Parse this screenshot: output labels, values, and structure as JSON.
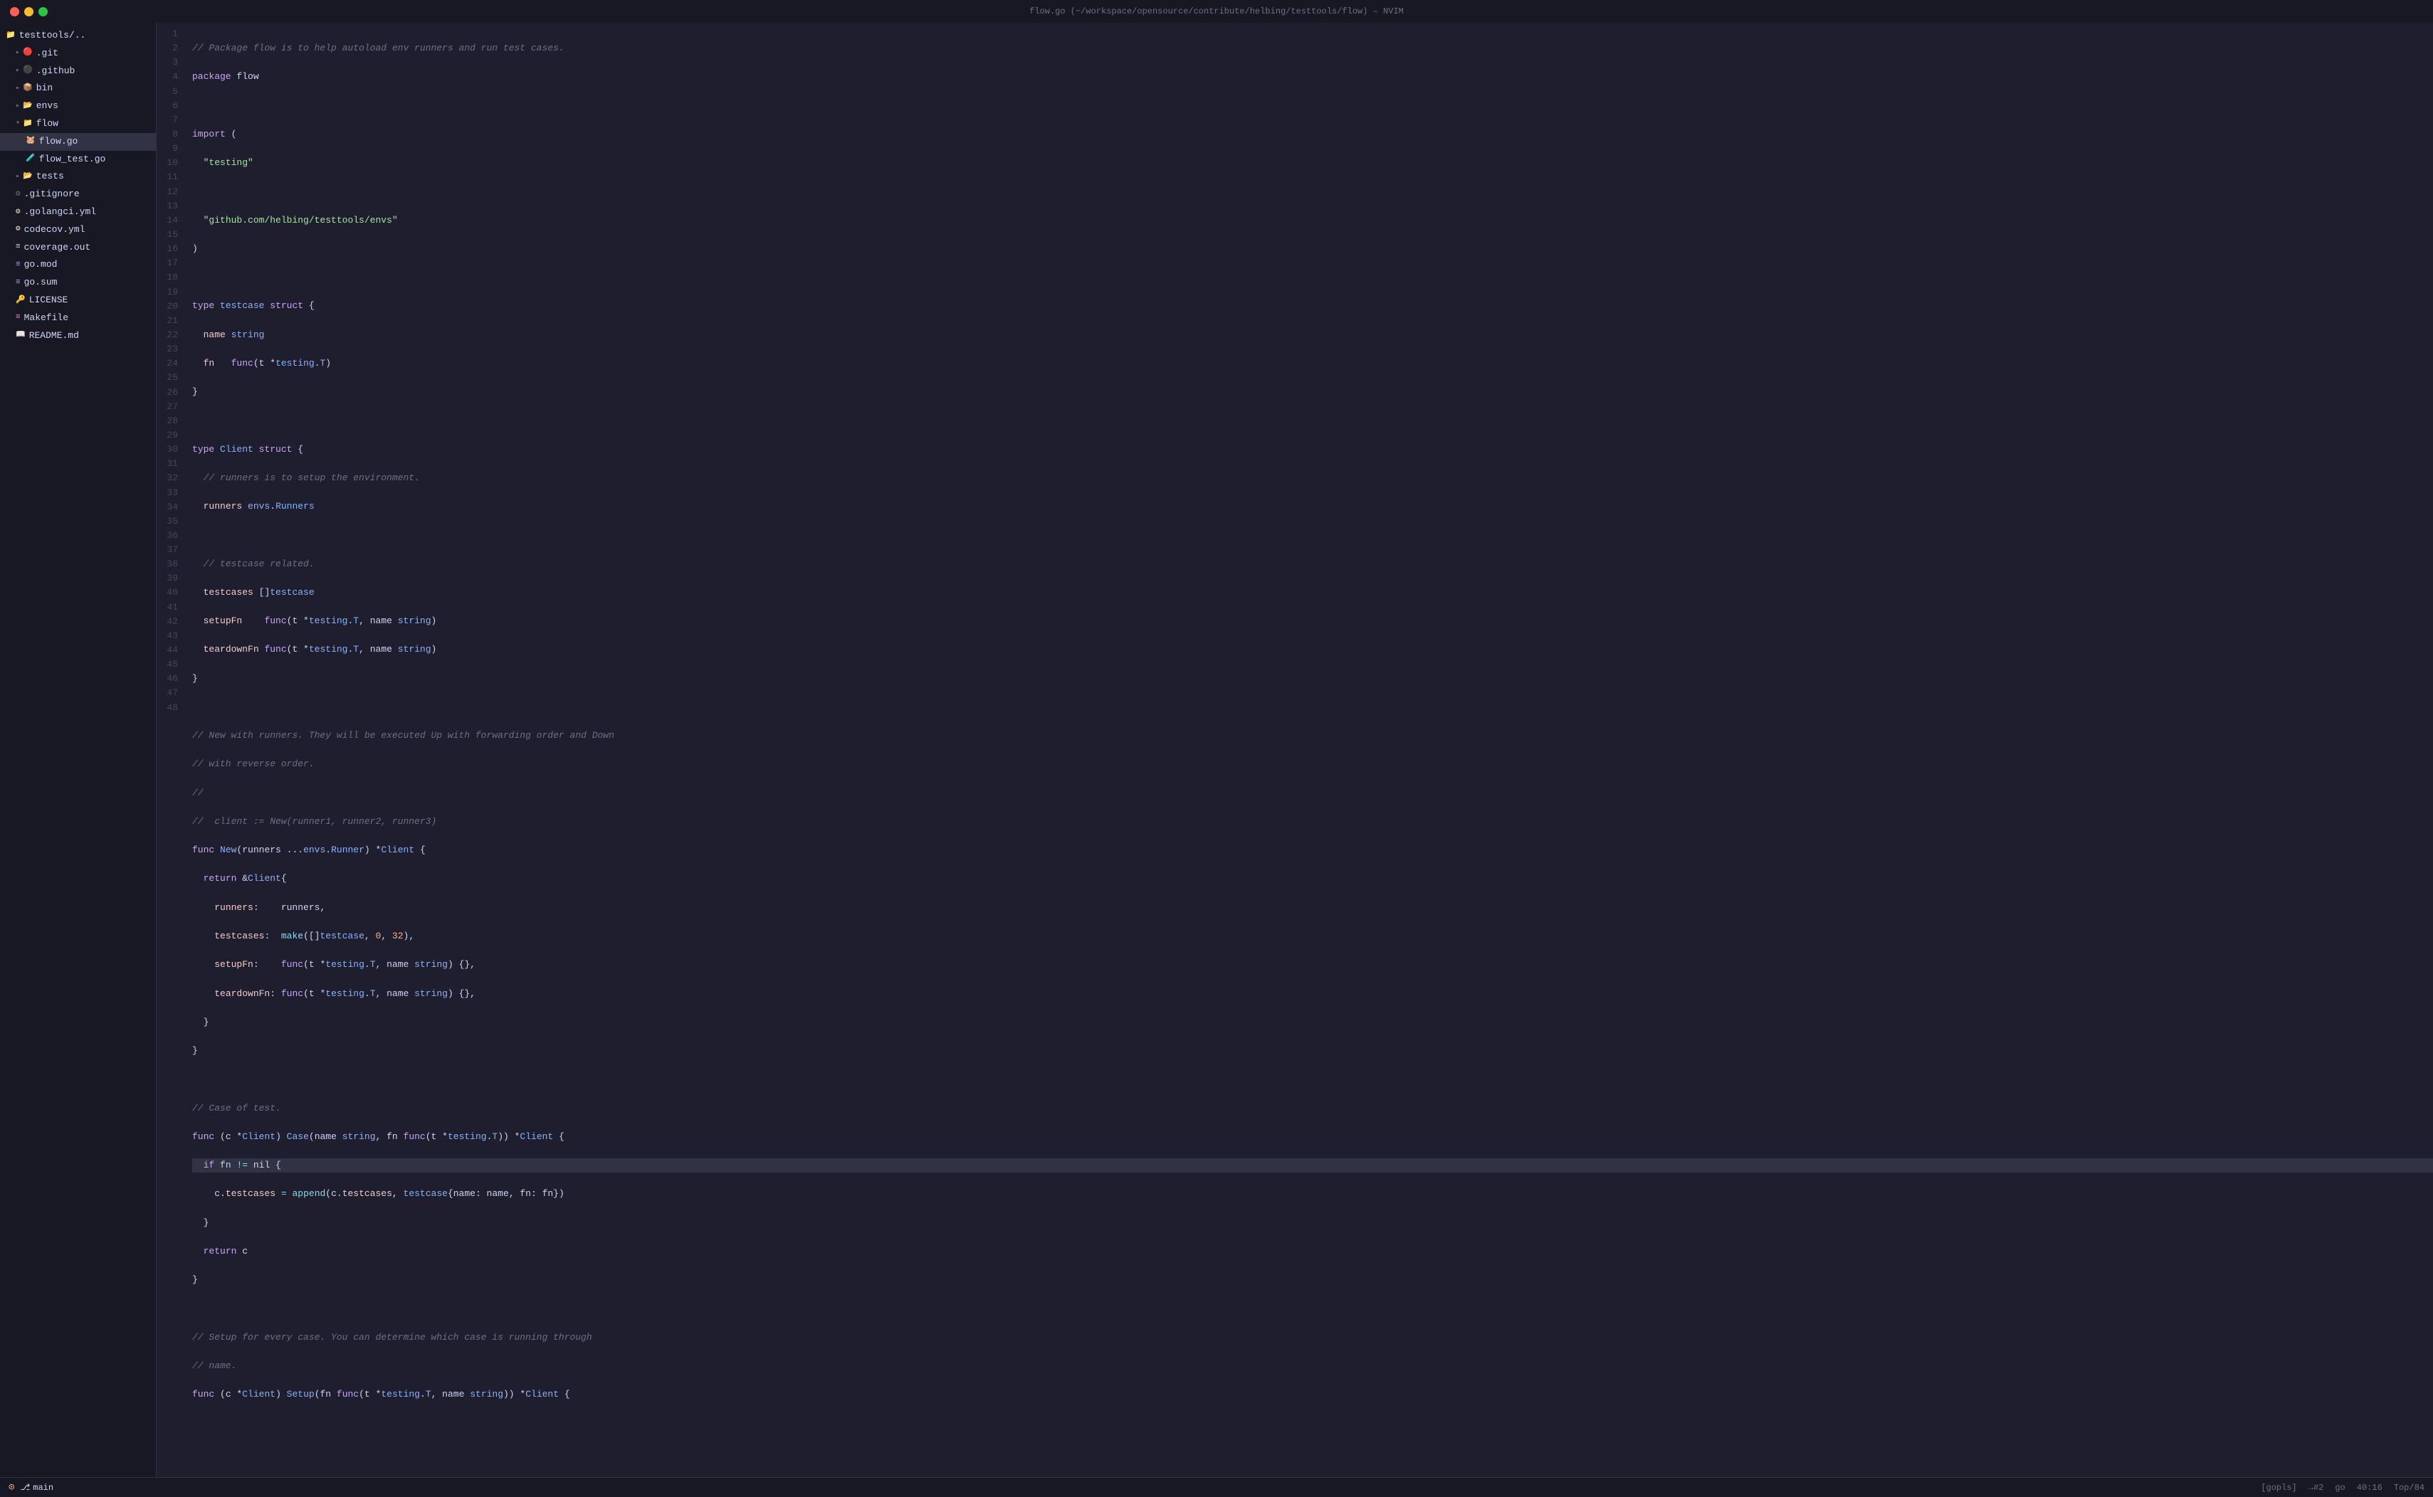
{
  "titlebar": {
    "title": "flow.go (~/workspace/opensource/contribute/helbing/testtools/flow) – NVIM"
  },
  "sidebar": {
    "root_label": "testtools/..",
    "items": [
      {
        "id": "git",
        "label": ".git",
        "indent": 1,
        "icon": "▸",
        "icon_type": "git",
        "expanded": false
      },
      {
        "id": "github",
        "label": ".github",
        "indent": 1,
        "icon": "▸",
        "icon_type": "github",
        "expanded": false
      },
      {
        "id": "bin",
        "label": "bin",
        "indent": 1,
        "icon": "▸",
        "icon_type": "bin",
        "expanded": false
      },
      {
        "id": "envs",
        "label": "envs",
        "indent": 1,
        "icon": "▸",
        "icon_type": "env",
        "expanded": false
      },
      {
        "id": "flow",
        "label": "flow",
        "indent": 1,
        "icon": "▾",
        "icon_type": "flow-dir",
        "expanded": true
      },
      {
        "id": "flow.go",
        "label": "flow.go",
        "indent": 2,
        "icon": "",
        "icon_type": "go",
        "active": true
      },
      {
        "id": "flow_test.go",
        "label": "flow_test.go",
        "indent": 2,
        "icon": "",
        "icon_type": "test"
      },
      {
        "id": "tests",
        "label": "tests",
        "indent": 1,
        "icon": "▸",
        "icon_type": "test",
        "expanded": false
      },
      {
        "id": "gitignore",
        "label": ".gitignore",
        "indent": 1,
        "icon": "",
        "icon_type": "gitignore"
      },
      {
        "id": "golangci",
        "label": ".golangci.yml",
        "indent": 1,
        "icon": "",
        "icon_type": "yaml"
      },
      {
        "id": "codecov",
        "label": "codecov.yml",
        "indent": 1,
        "icon": "",
        "icon_type": "codecov"
      },
      {
        "id": "coverage",
        "label": "coverage.out",
        "indent": 1,
        "icon": "",
        "icon_type": "coverage"
      },
      {
        "id": "gomod",
        "label": "go.mod",
        "indent": 1,
        "icon": "",
        "icon_type": "gomod"
      },
      {
        "id": "gosum",
        "label": "go.sum",
        "indent": 1,
        "icon": "",
        "icon_type": "gomod"
      },
      {
        "id": "license",
        "label": "LICENSE",
        "indent": 1,
        "icon": "",
        "icon_type": "license"
      },
      {
        "id": "makefile",
        "label": "Makefile",
        "indent": 1,
        "icon": "",
        "icon_type": "makefile"
      },
      {
        "id": "readme",
        "label": "README.md",
        "indent": 1,
        "icon": "",
        "icon_type": "readme"
      }
    ]
  },
  "statusbar": {
    "branch_icon": "⌥",
    "branch": "main",
    "lsp": "[gopls]",
    "info": "→#2",
    "go_icon": "go",
    "position": "40:16",
    "scroll": "Top/84"
  },
  "code": {
    "lines": [
      {
        "n": 1,
        "content": "comment",
        "raw": "// Package flow is to help autoload env runners and run test cases."
      },
      {
        "n": 2,
        "content": "keyword+plain",
        "raw": "package flow"
      },
      {
        "n": 3,
        "content": "empty",
        "raw": ""
      },
      {
        "n": 4,
        "content": "keyword+plain",
        "raw": "import ("
      },
      {
        "n": 5,
        "content": "string",
        "raw": "  \"testing\""
      },
      {
        "n": 6,
        "content": "empty",
        "raw": ""
      },
      {
        "n": 7,
        "content": "string",
        "raw": "  \"github.com/helbing/testtools/envs\""
      },
      {
        "n": 8,
        "content": "plain",
        "raw": ")"
      },
      {
        "n": 9,
        "content": "empty",
        "raw": ""
      },
      {
        "n": 10,
        "content": "type-def",
        "raw": "type testcase struct {"
      },
      {
        "n": 11,
        "content": "field",
        "raw": "  name string"
      },
      {
        "n": 12,
        "content": "field-fn",
        "raw": "  fn   func(t *testing.T)"
      },
      {
        "n": 13,
        "content": "plain",
        "raw": "}"
      },
      {
        "n": 14,
        "content": "empty",
        "raw": ""
      },
      {
        "n": 15,
        "content": "type-def2",
        "raw": "type Client struct {"
      },
      {
        "n": 16,
        "content": "comment",
        "raw": "  // runners is to setup the environment."
      },
      {
        "n": 17,
        "content": "field-runners",
        "raw": "  runners envs.Runners"
      },
      {
        "n": 18,
        "content": "empty",
        "raw": ""
      },
      {
        "n": 19,
        "content": "comment",
        "raw": "  // testcase related."
      },
      {
        "n": 20,
        "content": "field-testcases",
        "raw": "  testcases []testcase"
      },
      {
        "n": 21,
        "content": "field-setup",
        "raw": "  setupFn    func(t *testing.T, name string)"
      },
      {
        "n": 22,
        "content": "field-teardown",
        "raw": "  teardownFn func(t *testing.T, name string)"
      },
      {
        "n": 23,
        "content": "plain",
        "raw": "}"
      },
      {
        "n": 24,
        "content": "empty",
        "raw": ""
      },
      {
        "n": 25,
        "content": "comment",
        "raw": "// New with runners. They will be executed Up with forwarding order and Down"
      },
      {
        "n": 26,
        "content": "comment",
        "raw": "// with reverse order."
      },
      {
        "n": 27,
        "content": "comment",
        "raw": "//"
      },
      {
        "n": 28,
        "content": "comment",
        "raw": "//  client := New(runner1, runner2, runner3)"
      },
      {
        "n": 29,
        "content": "func-new",
        "raw": "func New(runners ...envs.Runner) *Client {"
      },
      {
        "n": 30,
        "content": "return-client",
        "raw": "  return &Client{"
      },
      {
        "n": 31,
        "content": "field-runners-val",
        "raw": "    runners:    runners,"
      },
      {
        "n": 32,
        "content": "field-testcases-val",
        "raw": "    testcases:  make([]testcase, 0, 32),"
      },
      {
        "n": 33,
        "content": "field-setup-val",
        "raw": "    setupFn:    func(t *testing.T, name string) {},"
      },
      {
        "n": 34,
        "content": "field-teardown-val",
        "raw": "    teardownFn: func(t *testing.T, name string) {},"
      },
      {
        "n": 35,
        "content": "plain",
        "raw": "  }"
      },
      {
        "n": 36,
        "content": "plain",
        "raw": "}"
      },
      {
        "n": 37,
        "content": "empty",
        "raw": ""
      },
      {
        "n": 38,
        "content": "comment",
        "raw": "// Case of test."
      },
      {
        "n": 39,
        "content": "func-case",
        "raw": "func (c *Client) Case(name string, fn func(t *testing.T)) *Client {"
      },
      {
        "n": 40,
        "content": "if-fn",
        "raw": "  if fn != nil {",
        "current": true
      },
      {
        "n": 41,
        "content": "append-line",
        "raw": "    c.testcases = append(c.testcases, testcase{name: name, fn: fn})"
      },
      {
        "n": 42,
        "content": "plain",
        "raw": "  }"
      },
      {
        "n": 43,
        "content": "return-c",
        "raw": "  return c"
      },
      {
        "n": 44,
        "content": "plain",
        "raw": "}"
      },
      {
        "n": 45,
        "content": "empty",
        "raw": ""
      },
      {
        "n": 46,
        "content": "comment",
        "raw": "// Setup for every case. You can determine which case is running through"
      },
      {
        "n": 47,
        "content": "comment",
        "raw": "// name."
      },
      {
        "n": 48,
        "content": "func-setup",
        "raw": "func (c *Client) Setup(fn func(t *testing.T, name string)) *Client {"
      }
    ]
  }
}
